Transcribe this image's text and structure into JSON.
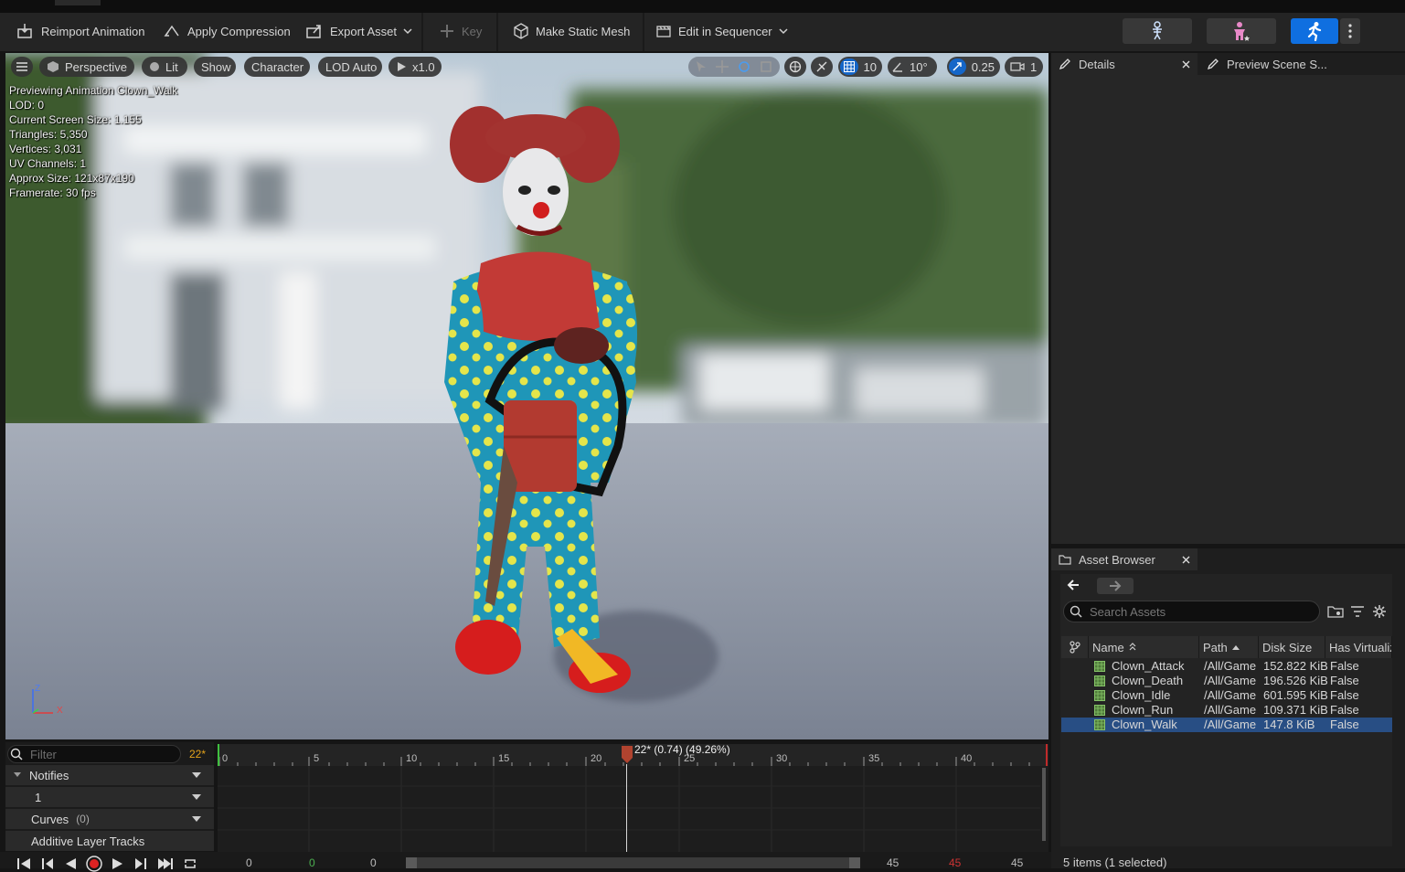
{
  "toolbar": {
    "reimport": "Reimport Animation",
    "compression": "Apply Compression",
    "export": "Export Asset",
    "key": "Key",
    "static_mesh": "Make Static Mesh",
    "sequencer": "Edit in Sequencer"
  },
  "viewport": {
    "perspective": "Perspective",
    "lit": "Lit",
    "show": "Show",
    "character": "Character",
    "lod": "LOD Auto",
    "speed": "x1.0",
    "grid_value": "10",
    "angle_value": "10°",
    "scale_value": "0.25",
    "camera_speed": "1",
    "stats": [
      "Previewing Animation Clown_Walk",
      "LOD: 0",
      "Current Screen Size: 1.155",
      "Triangles: 5,350",
      "Vertices: 3,031",
      "UV Channels: 1",
      "Approx Size: 121x87x190",
      "Framerate: 30 fps"
    ],
    "axis_z": "Z",
    "axis_x": "X"
  },
  "details": {
    "tab1": "Details",
    "tab2": "Preview Scene S..."
  },
  "asset_browser": {
    "title": "Asset Browser",
    "search_placeholder": "Search Assets",
    "columns": {
      "name": "Name",
      "path": "Path",
      "disk": "Disk Size",
      "virt": "Has Virtualiz"
    },
    "rows": [
      {
        "name": "Clown_Attack",
        "path": "/All/Game",
        "disk": "152.822 KiB",
        "virt": "False"
      },
      {
        "name": "Clown_Death",
        "path": "/All/Game",
        "disk": "196.526 KiB",
        "virt": "False"
      },
      {
        "name": "Clown_Idle",
        "path": "/All/Game",
        "disk": "601.595 KiB",
        "virt": "False"
      },
      {
        "name": "Clown_Run",
        "path": "/All/Game",
        "disk": "109.371 KiB",
        "virt": "False"
      },
      {
        "name": "Clown_Walk",
        "path": "/All/Game",
        "disk": "147.8 KiB",
        "virt": "False"
      }
    ],
    "status": "5 items (1 selected)"
  },
  "timeline": {
    "filter_placeholder": "Filter",
    "frame_badge": "22*",
    "notifies": "Notifies",
    "notify_track": "1",
    "curves": "Curves",
    "curves_count": "(0)",
    "additive": "Additive Layer Tracks",
    "playhead_label": "22* (0.74) (49.26%)",
    "ticks": [
      "0",
      "5",
      "10",
      "15",
      "20",
      "25",
      "30",
      "35",
      "40"
    ],
    "range_values": [
      "0",
      "0",
      "0",
      "45",
      "45",
      "45"
    ]
  }
}
